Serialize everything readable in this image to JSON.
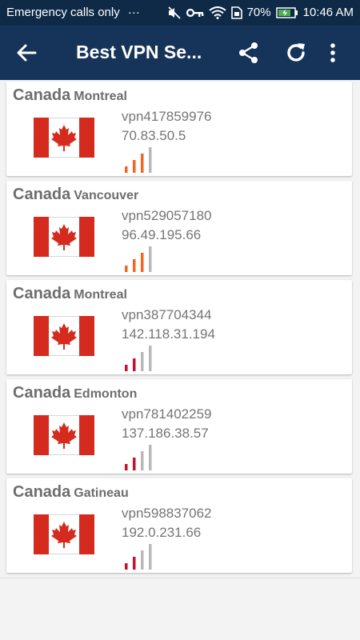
{
  "status_bar": {
    "carrier": "Emergency calls only",
    "overflow": "···",
    "battery": "70%",
    "time": "10:46 AM",
    "icons": [
      "mute-icon",
      "key-icon",
      "wifi-icon",
      "sim-icon",
      "battery-icon"
    ]
  },
  "toolbar": {
    "title": "Best VPN Se...",
    "icons": [
      "back-arrow-icon",
      "share-icon",
      "refresh-icon",
      "more-vertical-icon"
    ]
  },
  "colors": {
    "toolbar": "#163459",
    "statusbar": "#0e2a47",
    "signal_orange": "#f26522",
    "signal_red": "#c8102e",
    "signal_gray": "#b8b8b8",
    "flag_red": "#d52b1e"
  },
  "servers": [
    {
      "country": "Canada",
      "city": "Montreal",
      "host": "vpn417859976",
      "ip": "70.83.50.5",
      "signal_bars": 3,
      "signal_color": "orange",
      "flag": "canada-flag-icon"
    },
    {
      "country": "Canada",
      "city": "Vancouver",
      "host": "vpn529057180",
      "ip": "96.49.195.66",
      "signal_bars": 3,
      "signal_color": "orange",
      "flag": "canada-flag-icon"
    },
    {
      "country": "Canada",
      "city": "Montreal",
      "host": "vpn387704344",
      "ip": "142.118.31.194",
      "signal_bars": 2,
      "signal_color": "red",
      "flag": "canada-flag-icon"
    },
    {
      "country": "Canada",
      "city": "Edmonton",
      "host": "vpn781402259",
      "ip": "137.186.38.57",
      "signal_bars": 2,
      "signal_color": "red",
      "flag": "canada-flag-icon"
    },
    {
      "country": "Canada",
      "city": "Gatineau",
      "host": "vpn598837062",
      "ip": "192.0.231.66",
      "signal_bars": 2,
      "signal_color": "red",
      "flag": "canada-flag-icon"
    }
  ]
}
